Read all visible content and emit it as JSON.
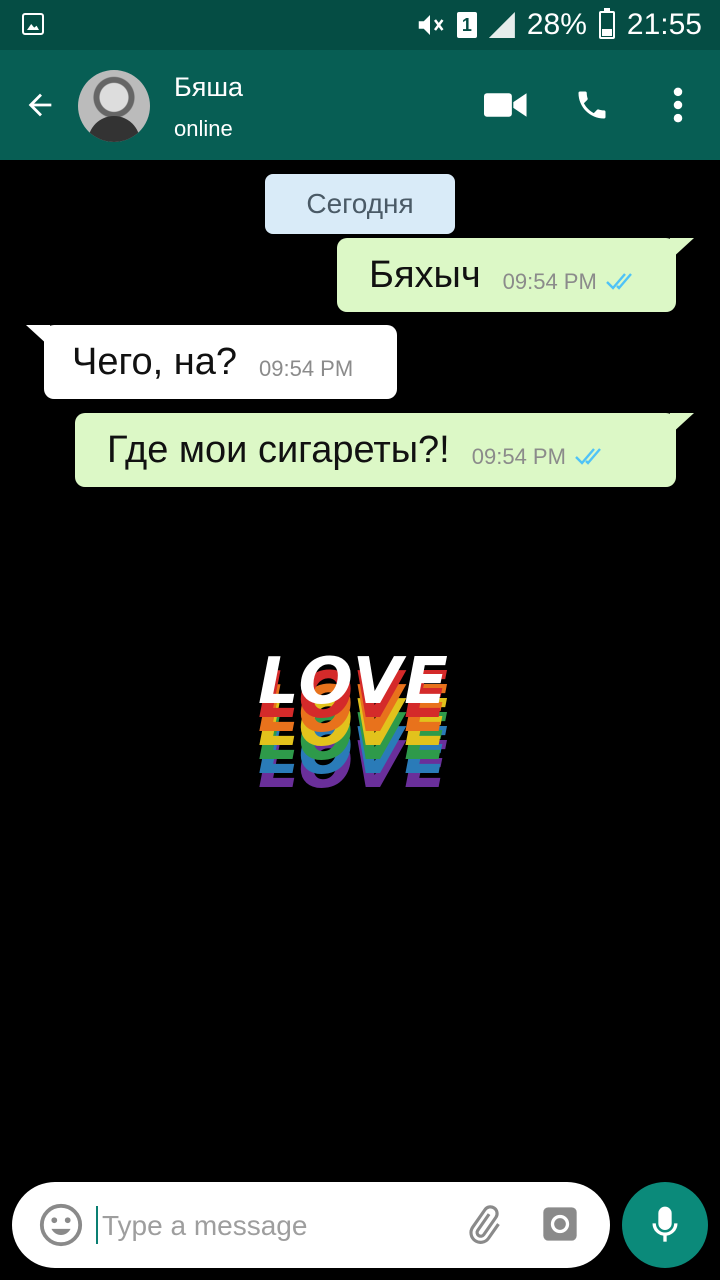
{
  "status_bar": {
    "battery": "28%",
    "time": "21:55",
    "sim": "1"
  },
  "header": {
    "contact_name": "Бяша",
    "contact_status": "online"
  },
  "chat": {
    "date_label": "Сегодня",
    "messages": [
      {
        "direction": "outgoing",
        "text": "Бяхыч",
        "time": "09:54 PM",
        "read": true
      },
      {
        "direction": "incoming",
        "text": "Чего, на?",
        "time": "09:54 PM"
      },
      {
        "direction": "outgoing",
        "text": "Где мои сигареты?!",
        "time": "09:54 PM",
        "read": true
      }
    ],
    "wallpaper_text": "LOVE"
  },
  "composer": {
    "placeholder": "Type a message"
  },
  "colors": {
    "header": "#075e54",
    "status_bar": "#054d44",
    "outgoing_bubble": "#dcf8c6",
    "incoming_bubble": "#ffffff",
    "read_ticks": "#4fc3f7",
    "mic_button": "#0b8a7a"
  },
  "icons": [
    "back-arrow-icon",
    "video-call-icon",
    "phone-icon",
    "more-vert-icon",
    "emoji-icon",
    "attach-icon",
    "camera-icon",
    "mic-icon"
  ]
}
